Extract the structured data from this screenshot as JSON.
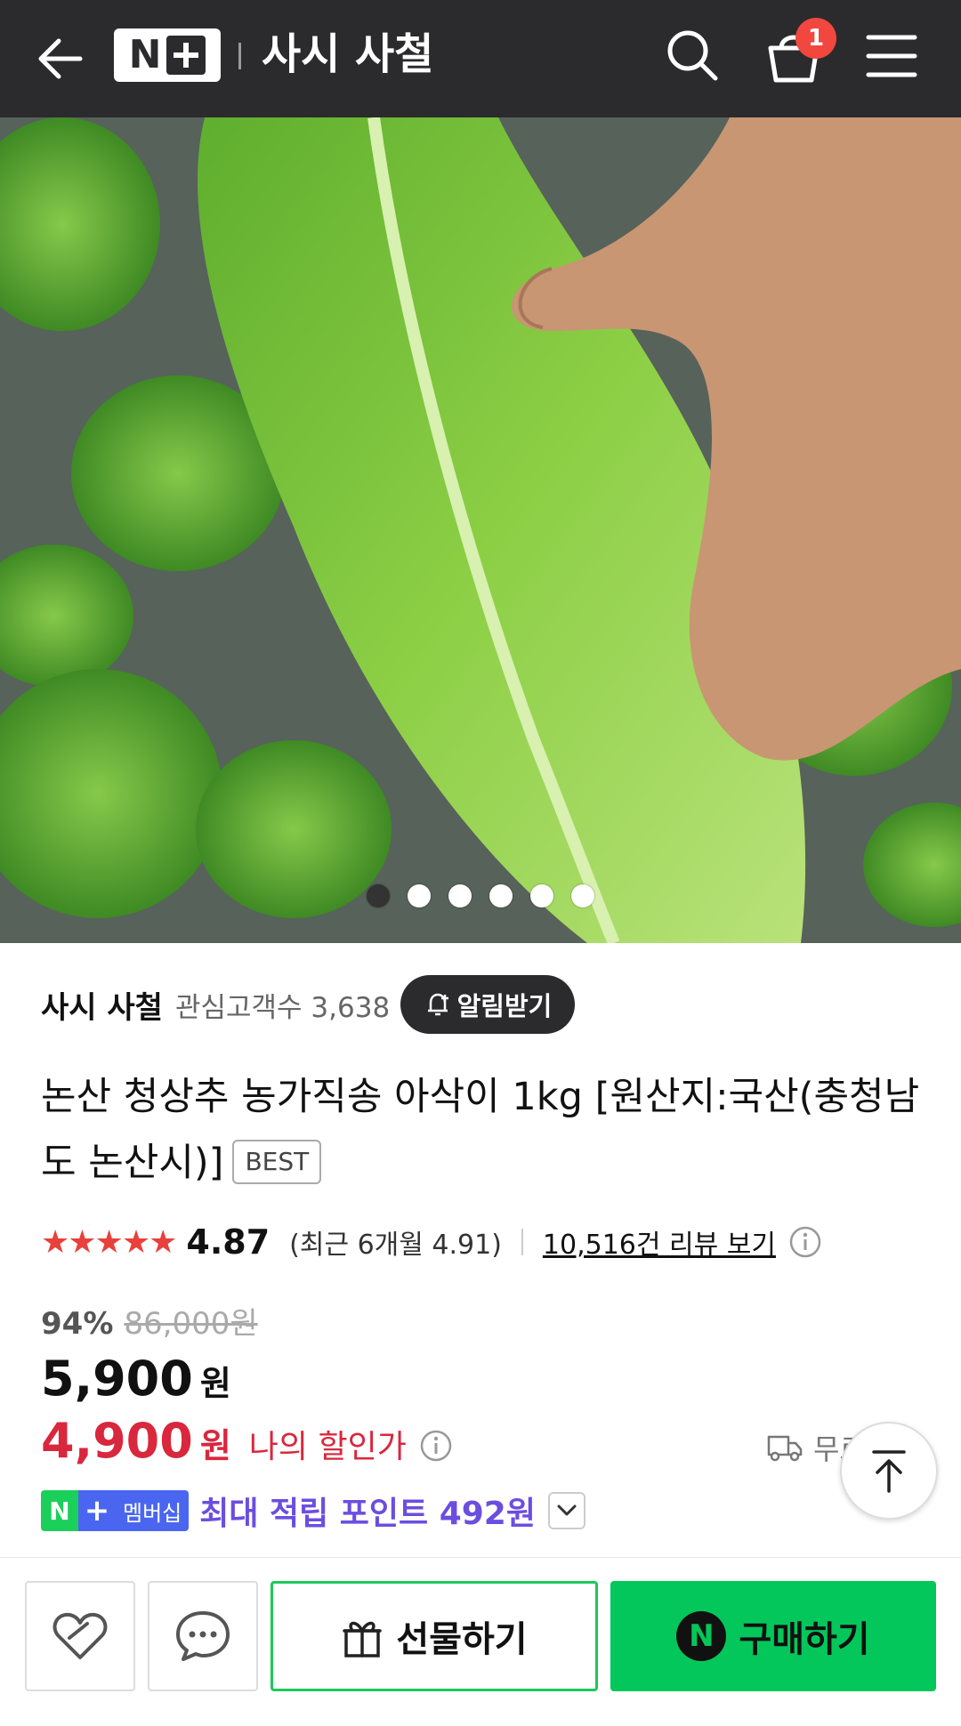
{
  "header": {
    "logo_n": "N",
    "store_title": "사시 사철",
    "cart_count": "1"
  },
  "gallery": {
    "dots_total": 6,
    "active_index": 0
  },
  "store": {
    "name": "사시 사철",
    "followers": "관심고객수 3,638",
    "alert_label": "알림받기"
  },
  "product": {
    "title": "논산 청상추 농가직송 아삭이 1kg [원산지:국산(충청남도 논산시)]",
    "badge": "BEST"
  },
  "rating": {
    "stars": "★★★★★",
    "value": "4.87",
    "recent": "(최근 6개월 4.91)",
    "reviews_link": "10,516건 리뷰 보기"
  },
  "price": {
    "discount_pct": "94%",
    "original": "86,000원",
    "sale": "5,900",
    "sale_unit": "원",
    "my_price": "4,900",
    "my_unit": "원",
    "my_label": "나의 할인가"
  },
  "delivery": {
    "label": "무료"
  },
  "membership": {
    "n": "N",
    "plus": "+",
    "label": "멤버십",
    "points": "최대 적립 포인트 492원"
  },
  "bottom": {
    "gift_label": "선물하기",
    "buy_n": "N",
    "buy_label": "구매하기"
  },
  "colors": {
    "header_bg": "#2b2b2d",
    "badge_red": "#f2473f",
    "sale_red": "#d9273d",
    "naver_green": "#03c75a",
    "membership_purple": "#6b4ee0"
  }
}
